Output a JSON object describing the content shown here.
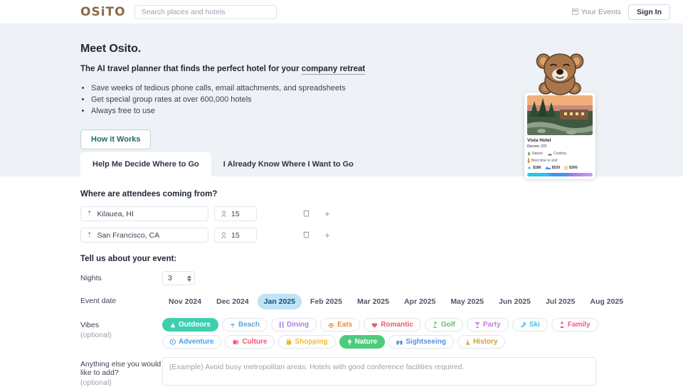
{
  "header": {
    "logo": "OSiTO",
    "search_placeholder": "Search places and hotels",
    "search_value": "",
    "your_events": "Your Events",
    "sign_in": "Sign In"
  },
  "hero": {
    "title": "Meet Osito.",
    "subtitle_prefix": "The AI travel planner that finds the perfect hotel for your ",
    "subtitle_link": "company retreat",
    "bullets": [
      "Save weeks of tedious phone calls, email attachments, and spreadsheets",
      "Get special group rates at over 600,000 hotels",
      "Always free to use"
    ],
    "how_it_works": "How it Works"
  },
  "hotel_card": {
    "name": "Vista Hotel",
    "location": "Denver, CO",
    "tags": [
      {
        "label": "Nature",
        "icon": "tree-icon",
        "color": "#4aaa6a"
      },
      {
        "label": "Cowboy",
        "icon": "cowboy-icon",
        "color": "#6d7686"
      }
    ],
    "best_time": "Best time to visit",
    "prices": [
      {
        "label": "$186",
        "icon": "flight-icon",
        "color": "#34b6e8"
      },
      {
        "label": "$520",
        "icon": "bed-icon",
        "color": "#4a8ef0"
      },
      {
        "label": "$300",
        "icon": "food-icon",
        "color": "#e8a23a"
      }
    ]
  },
  "tabs": [
    {
      "label": "Help Me Decide Where to Go",
      "active": true
    },
    {
      "label": "I Already Know Where I Want to Go",
      "active": false
    }
  ],
  "form": {
    "origin_title": "Where are attendees coming from?",
    "locations": [
      {
        "place": "Kilauea, HI",
        "count": "15"
      },
      {
        "place": "San Francisco, CA",
        "count": "15"
      }
    ],
    "event_title": "Tell us about your event:",
    "nights_label": "Nights",
    "nights_value": "3",
    "event_date_label": "Event date",
    "months": [
      {
        "label": "Nov 2024",
        "selected": false
      },
      {
        "label": "Dec 2024",
        "selected": false
      },
      {
        "label": "Jan 2025",
        "selected": true
      },
      {
        "label": "Feb 2025",
        "selected": false
      },
      {
        "label": "Mar 2025",
        "selected": false
      },
      {
        "label": "Apr 2025",
        "selected": false
      },
      {
        "label": "May 2025",
        "selected": false
      },
      {
        "label": "Jun 2025",
        "selected": false
      },
      {
        "label": "Jul 2025",
        "selected": false
      },
      {
        "label": "Aug 2025",
        "selected": false
      }
    ],
    "vibes_label": "Vibes",
    "optional_label": "(optional)",
    "vibes": [
      {
        "label": "Outdoors",
        "icon": "mountain-icon",
        "color": "#3ecfae",
        "selected": true
      },
      {
        "label": "Beach",
        "icon": "umbrella-icon",
        "color": "#5aa9e6",
        "selected": false
      },
      {
        "label": "Dining",
        "icon": "cutlery-icon",
        "color": "#b07de0",
        "selected": false
      },
      {
        "label": "Eats",
        "icon": "burger-icon",
        "color": "#f08a3c",
        "selected": false
      },
      {
        "label": "Romantic",
        "icon": "heart-icon",
        "color": "#f0566e",
        "selected": false
      },
      {
        "label": "Golf",
        "icon": "golf-icon",
        "color": "#5fbf72",
        "selected": false
      },
      {
        "label": "Party",
        "icon": "cocktail-icon",
        "color": "#c77de0",
        "selected": false
      },
      {
        "label": "Ski",
        "icon": "ski-icon",
        "color": "#39c2e8",
        "selected": false
      },
      {
        "label": "Family",
        "icon": "family-icon",
        "color": "#f0598c",
        "selected": false
      },
      {
        "label": "Adventure",
        "icon": "compass-icon",
        "color": "#4a9fe8",
        "selected": false
      },
      {
        "label": "Culture",
        "icon": "masks-icon",
        "color": "#f0566e",
        "selected": false
      },
      {
        "label": "Shopping",
        "icon": "bag-icon",
        "color": "#f0b83c",
        "selected": false
      },
      {
        "label": "Nature",
        "icon": "tree-icon",
        "color": "#4ecb7d",
        "selected": true
      },
      {
        "label": "Sightseeing",
        "icon": "binocular-icon",
        "color": "#5a8ee0",
        "selected": false
      },
      {
        "label": "History",
        "icon": "monument-icon",
        "color": "#c9a23a",
        "selected": false
      }
    ],
    "notes_label_line1": "Anything else you would",
    "notes_label_line2": "like to add?",
    "notes_placeholder": "(Example) Avoid busy metropolitan areas. Hotels with good conference facilities required.",
    "notes_value": ""
  }
}
